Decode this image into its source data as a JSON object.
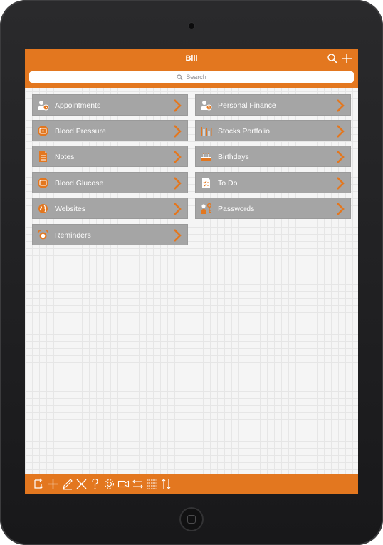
{
  "header": {
    "title": "Bill"
  },
  "search": {
    "placeholder": "Search"
  },
  "items": [
    {
      "label": "Appointments",
      "icon": "person-clock-icon"
    },
    {
      "label": "Personal Finance",
      "icon": "person-money-icon"
    },
    {
      "label": "Blood Pressure",
      "icon": "heart-monitor-icon"
    },
    {
      "label": "Stocks Portfolio",
      "icon": "bar-chart-icon"
    },
    {
      "label": "Notes",
      "icon": "document-icon"
    },
    {
      "label": "Birthdays",
      "icon": "cake-icon"
    },
    {
      "label": "Blood Glucose",
      "icon": "glucose-meter-icon"
    },
    {
      "label": "To Do",
      "icon": "checklist-icon"
    },
    {
      "label": "Websites",
      "icon": "globe-icon"
    },
    {
      "label": "Passwords",
      "icon": "person-key-icon"
    },
    {
      "label": "Reminders",
      "icon": "alarm-clock-icon"
    }
  ],
  "toolbar": {
    "tools": [
      "sync-icon",
      "add-icon",
      "edit-icon",
      "delete-icon",
      "help-icon",
      "settings-icon",
      "video-icon",
      "reorder-icon",
      "grid-icon",
      "sort-icon"
    ]
  },
  "colors": {
    "accent": "#e3771f",
    "tile": "#a5a5a5",
    "tile_text": "#ffffff"
  }
}
